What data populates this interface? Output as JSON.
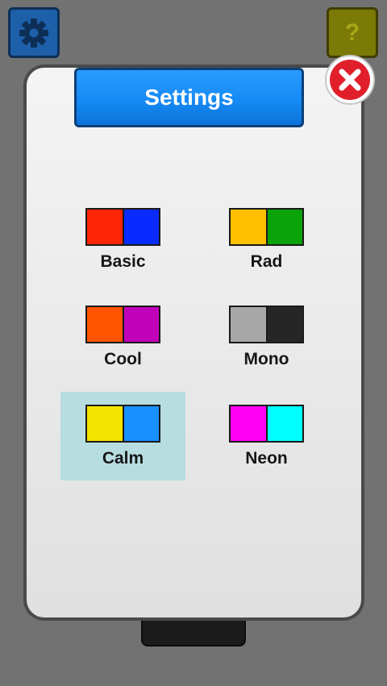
{
  "header": {
    "settings_icon": "gear-icon",
    "help_icon": "question-mark-icon",
    "help_label": "?"
  },
  "dialog": {
    "title": "Settings",
    "close_icon": "close-x-icon"
  },
  "colors": {
    "title_blue": "#168af5",
    "close_red": "#e11f2b",
    "selected_bg": "#b7dde0"
  },
  "themes": [
    {
      "name": "Basic",
      "colors": [
        "#fe2507",
        "#0a2bff"
      ],
      "selected": false
    },
    {
      "name": "Rad",
      "colors": [
        "#ffc000",
        "#0aa30a"
      ],
      "selected": false
    },
    {
      "name": "Cool",
      "colors": [
        "#ff5400",
        "#c100b9"
      ],
      "selected": false
    },
    {
      "name": "Mono",
      "colors": [
        "#a7a7a7",
        "#262626"
      ],
      "selected": false
    },
    {
      "name": "Calm",
      "colors": [
        "#f5e400",
        "#1890ff"
      ],
      "selected": true
    },
    {
      "name": "Neon",
      "colors": [
        "#ff00f5",
        "#00ffff"
      ],
      "selected": false
    }
  ]
}
